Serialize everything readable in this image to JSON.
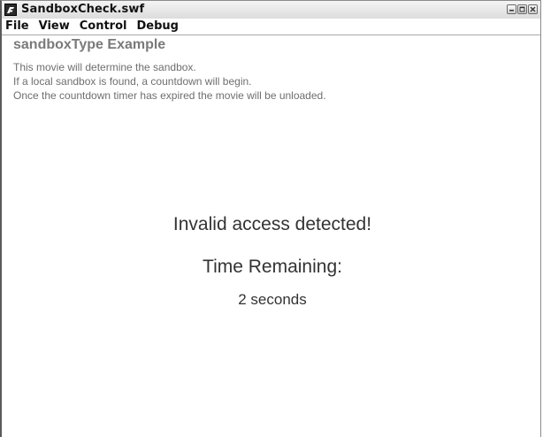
{
  "window": {
    "title": "SandboxCheck.swf"
  },
  "menu": {
    "items": [
      "File",
      "View",
      "Control",
      "Debug"
    ]
  },
  "content": {
    "heading": "sandboxType Example",
    "lines": [
      "This movie will determine the sandbox.",
      "If a local sandbox is found, a countdown will begin.",
      "Once the countdown timer has expired the movie will be unloaded."
    ],
    "alert": "Invalid access detected!",
    "time_label": "Time Remaining:",
    "time_value": "2 seconds"
  },
  "icons": {
    "app": "flash-player-icon",
    "minimize": "minimize-icon",
    "maximize": "maximize-icon",
    "close": "close-icon"
  },
  "colors": {
    "heading": "#7a7a7a",
    "description": "#6e6e6e",
    "center_text": "#333333"
  }
}
